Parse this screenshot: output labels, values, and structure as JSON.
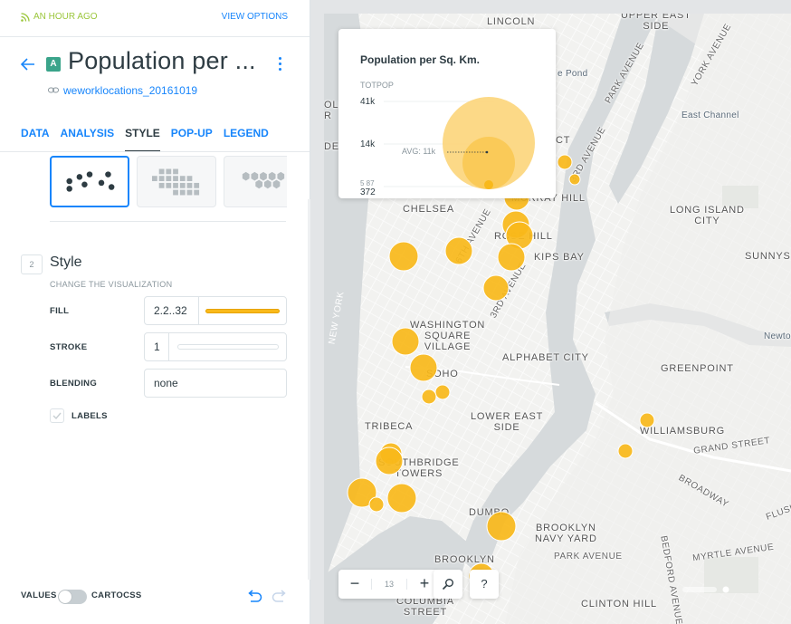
{
  "header": {
    "publish_status": "AN HOUR AGO",
    "view_options": "VIEW OPTIONS"
  },
  "layer": {
    "badge": "A",
    "title": "Population per ...",
    "dataset": "weworklocations_20161019"
  },
  "tabs": [
    {
      "label": "DATA",
      "active": false
    },
    {
      "label": "ANALYSIS",
      "active": false
    },
    {
      "label": "STYLE",
      "active": true
    },
    {
      "label": "POP-UP",
      "active": false
    },
    {
      "label": "LEGEND",
      "active": false
    }
  ],
  "style_section": {
    "step": "2",
    "title": "Style",
    "subtitle": "CHANGE THE VISUALIZATION",
    "fill_label": "FILL",
    "fill_value": "2.2..32",
    "fill_color": "#f9b91a",
    "stroke_label": "STROKE",
    "stroke_value": "1",
    "blending_label": "BLENDING",
    "blending_value": "none",
    "labels_checkbox": "LABELS"
  },
  "footer": {
    "values_label": "VALUES",
    "cartocss_label": "CARTOCSS"
  },
  "legend": {
    "title": "Population per Sq. Km.",
    "field": "TOTPOP",
    "max": "41k",
    "mid": "14k",
    "min_partial": "5 87",
    "min": "372",
    "avg": "AVG: 11k"
  },
  "map": {
    "zoom_level": "13",
    "zoom_out": "−",
    "zoom_in": "+",
    "search": "⚲",
    "help": "?",
    "labels": {
      "lincoln": "LINCOLN",
      "upper_east_side": "UPPER EAST\nSIDE",
      "park_avenue": "PARK AVENUE",
      "york_avenue": "YORK AVENUE",
      "third_avenue_top": "3RD AVENUE",
      "east_channel": "East Channel",
      "murray_hill": "MURRAY HILL",
      "chelsea": "CHELSEA",
      "sixth_avenue": "6TH AVENUE",
      "rose_hill": "ROSE HILL",
      "long_island_city": "LONG ISLAND\nCITY",
      "sunnyside": "SUNNYS",
      "kips_bay": "KIPS BAY",
      "third_avenue_mid": "3RD AVENUE",
      "new_york": "NEW YORK",
      "washington_square_village": "WASHINGTON\nSQUARE\nVILLAGE",
      "newtown": "Newto",
      "alphabet_city": "ALPHABET CITY",
      "greenpoint": "GREENPOINT",
      "soho": "SOHO",
      "lower_east_side": "LOWER EAST\nSIDE",
      "tribeca": "TRIBECA",
      "williamsburg": "WILLIAMSBURG",
      "grand_street": "GRAND STREET",
      "southbridge_towers": "SOUTHBRIDGE\nTOWERS",
      "broadway": "BROADWAY",
      "flushing": "FLUSH",
      "dumbo": "DUMBO",
      "brooklyn_navy_yard": "BROOKLYN\nNAVY YARD",
      "park_avenue_bk": "PARK AVENUE",
      "myrtle_avenue": "MYRTLE AVENUE",
      "bedford_avenue": "BEDFORD AVENUE",
      "brooklyn": "BROOKLYN",
      "columbia_street": "COLUMBIA\nSTREET",
      "clinton_hill": "CLINTON HILL",
      "pond": "e Pond",
      "ct": "CT",
      "olnr": "OLN\nR",
      "de": "DE"
    }
  },
  "colors": {
    "accent": "#1785fb",
    "published": "#9bc63b",
    "bubble": "#f9b91a",
    "water": "#d6dadc"
  }
}
